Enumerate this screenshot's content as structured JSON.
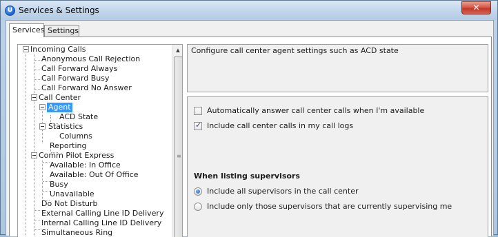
{
  "window": {
    "title": "Services & Settings",
    "app_icon_letter": "U",
    "close_glyph": "✕"
  },
  "tabs": [
    {
      "label": "Services",
      "active": true
    },
    {
      "label": "Settings",
      "active": false
    }
  ],
  "tree": {
    "items": [
      {
        "label": "Incoming Calls",
        "level": 0,
        "expander": "expanded"
      },
      {
        "label": "Anonymous Call Rejection",
        "level": 1
      },
      {
        "label": "Call Forward Always",
        "level": 1
      },
      {
        "label": "Call Forward Busy",
        "level": 1
      },
      {
        "label": "Call Forward No Answer",
        "level": 1
      },
      {
        "label": "Call Center",
        "level": 1,
        "expander": "expanded"
      },
      {
        "label": "Agent",
        "level": 2,
        "expander": "expanded",
        "selected": true
      },
      {
        "label": "ACD State",
        "level": 3
      },
      {
        "label": "Statistics",
        "level": 2,
        "expander": "expanded"
      },
      {
        "label": "Columns",
        "level": 3
      },
      {
        "label": "Reporting",
        "level": 2
      },
      {
        "label": "Comm Pilot Express",
        "level": 1,
        "expander": "expanded"
      },
      {
        "label": "Available: In Office",
        "level": 2
      },
      {
        "label": "Available: Out Of Office",
        "level": 2
      },
      {
        "label": "Busy",
        "level": 2
      },
      {
        "label": "Unavailable",
        "level": 2
      },
      {
        "label": "Do Not Disturb",
        "level": 1
      },
      {
        "label": "External Calling Line ID Delivery",
        "level": 1
      },
      {
        "label": "Internal Calling Line ID Delivery",
        "level": 1
      },
      {
        "label": "Simultaneous Ring",
        "level": 1
      }
    ]
  },
  "scrollbar": {
    "up_arrow": "▲",
    "grip": "≡"
  },
  "description": "Configure call center agent settings such as ACD state",
  "settings": {
    "auto_answer": {
      "label": "Automatically answer call center calls when I'm available",
      "checked": false
    },
    "include_logs": {
      "label": "Include call center calls in my call logs",
      "checked": true
    },
    "supervisors_heading": "When listing supervisors",
    "supervisors_all": {
      "label": "Include all supervisors in the call center",
      "selected": true
    },
    "supervisors_current": {
      "label": "Include only those supervisors that are currently supervising me",
      "selected": false
    }
  },
  "colors": {
    "selection": "#3399ff",
    "close_button": "#c2382a",
    "title_bar": "#c5d8ec"
  }
}
